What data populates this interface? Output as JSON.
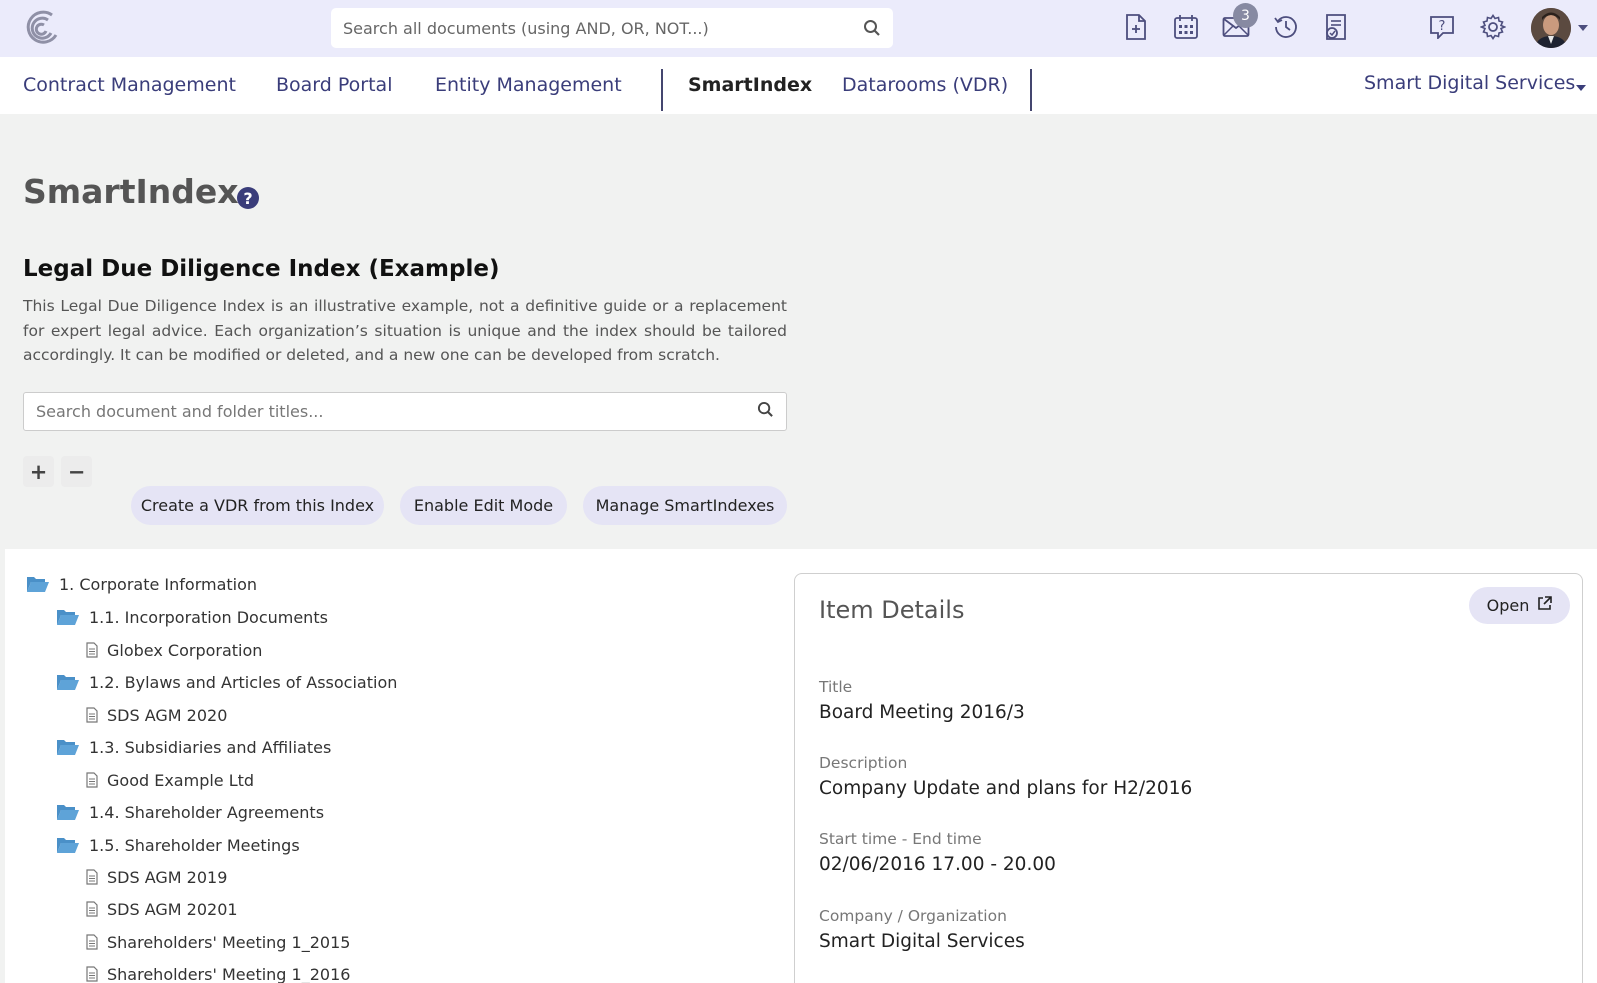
{
  "header": {
    "search_placeholder": "Search all documents (using AND, OR, NOT...)",
    "notification_count": "3",
    "icons": [
      "new-document-icon",
      "calendar-icon",
      "mail-icon",
      "history-icon",
      "reports-icon",
      "help-icon",
      "settings-icon",
      "avatar"
    ]
  },
  "nav": {
    "items": [
      {
        "label": "Contract Management"
      },
      {
        "label": "Board Portal"
      },
      {
        "label": "Entity Management"
      },
      {
        "label": "SmartIndex"
      },
      {
        "label": "Datarooms (VDR)"
      }
    ],
    "active": "SmartIndex",
    "organization": "Smart Digital Services"
  },
  "page": {
    "title": "SmartIndex",
    "index_title": "Legal Due Diligence Index (Example)",
    "index_description": "This Legal Due Diligence Index is an illustrative example, not a definitive guide or a replacement for expert legal advice. Each organization’s situation is unique and the index should be tailored accordingly. It can be modified or deleted, and a new one can be developed from scratch.",
    "tree_search_placeholder": "Search document and folder titles...",
    "expand_all_label": "+",
    "collapse_all_label": "−",
    "buttons": {
      "create_vdr": "Create a VDR from this Index",
      "edit_mode": "Enable Edit Mode",
      "manage": "Manage SmartIndexes"
    }
  },
  "tree": [
    {
      "type": "folder",
      "label": "1. Corporate Information"
    },
    {
      "type": "folder",
      "label": "1.1. Incorporation Documents"
    },
    {
      "type": "file",
      "label": "Globex Corporation"
    },
    {
      "type": "folder",
      "label": "1.2. Bylaws and Articles of Association"
    },
    {
      "type": "file",
      "label": "SDS AGM 2020"
    },
    {
      "type": "folder",
      "label": "1.3. Subsidiaries and Affiliates"
    },
    {
      "type": "file",
      "label": "Good Example Ltd"
    },
    {
      "type": "folder",
      "label": "1.4. Shareholder Agreements"
    },
    {
      "type": "folder",
      "label": "1.5. Shareholder Meetings"
    },
    {
      "type": "file",
      "label": "SDS AGM 2019"
    },
    {
      "type": "file",
      "label": "SDS AGM 20201"
    },
    {
      "type": "file",
      "label": "Shareholders' Meeting 1_2015"
    },
    {
      "type": "file",
      "label": "Shareholders' Meeting 1_2016"
    }
  ],
  "details": {
    "title": "Item Details",
    "open_label": "Open",
    "fields": [
      {
        "label": "Title",
        "value": "Board Meeting 2016/3"
      },
      {
        "label": "Description",
        "value": "Company Update and plans for H2/2016"
      },
      {
        "label": "Start time - End time",
        "value": "02/06/2016 17.00 - 20.00"
      },
      {
        "label": "Company / Organization",
        "value": "Smart Digital Services"
      }
    ]
  },
  "colors": {
    "topbar_bg": "#ebebfb",
    "nav_text": "#3a3d7a",
    "pill_bg": "#e5e4f5",
    "folder_icon": "#4a90c8",
    "page_bg": "#f1f2f1"
  }
}
